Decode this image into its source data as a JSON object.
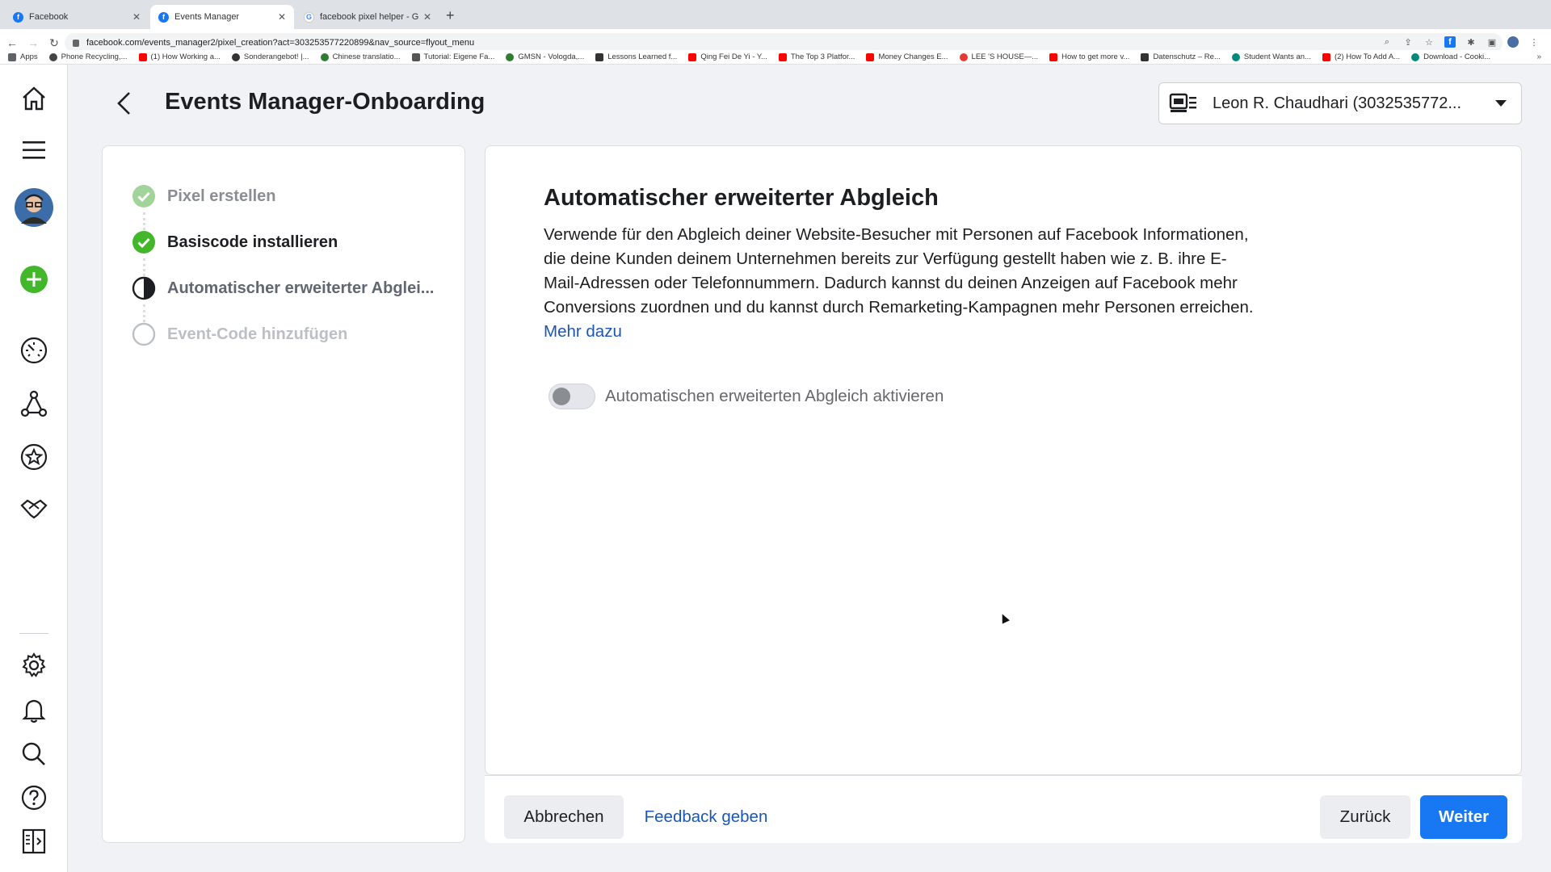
{
  "browser": {
    "tabs": [
      {
        "label": "Facebook",
        "active": false,
        "favicon": "facebook-icon",
        "color": "#1877f2"
      },
      {
        "label": "Events Manager",
        "active": true,
        "favicon": "facebook-icon",
        "color": "#1877f2"
      },
      {
        "label": "facebook pixel helper - Google",
        "active": false,
        "favicon": "google-icon",
        "color": "#4285f4"
      }
    ],
    "url": "facebook.com/events_manager2/pixel_creation?act=303253577220899&nav_source=flyout_menu",
    "bookmarks": [
      {
        "label": "Apps",
        "color": "#5f6368"
      },
      {
        "label": "Phone Recycling,...",
        "color": "#444444"
      },
      {
        "label": "(1) How Working a...",
        "color": "#ff0000"
      },
      {
        "label": "Sonderangebot! |...",
        "color": "#333333"
      },
      {
        "label": "Chinese translatio...",
        "color": "#2e7d32"
      },
      {
        "label": "Tutorial: Eigene Fa...",
        "color": "#555555"
      },
      {
        "label": "GMSN - Vologda,...",
        "color": "#2e7d32"
      },
      {
        "label": "Lessons Learned f...",
        "color": "#333333"
      },
      {
        "label": "Qing Fei De Yi - Y...",
        "color": "#ff0000"
      },
      {
        "label": "The Top 3 Platfor...",
        "color": "#ff0000"
      },
      {
        "label": "Money Changes E...",
        "color": "#ff0000"
      },
      {
        "label": "LEE 'S HOUSE—...",
        "color": "#e53935"
      },
      {
        "label": "How to get more v...",
        "color": "#ff0000"
      },
      {
        "label": "Datenschutz – Re...",
        "color": "#333333"
      },
      {
        "label": "Student Wants an...",
        "color": "#00897b"
      },
      {
        "label": "(2) How To Add A...",
        "color": "#ff0000"
      },
      {
        "label": "Download - Cooki...",
        "color": "#00897b"
      }
    ],
    "bookmarks_more": "»"
  },
  "header": {
    "title": "Events Manager-Onboarding",
    "account_label": "Leon R. Chaudhari (3032535772..."
  },
  "steps": [
    {
      "label": "Pixel erstellen",
      "state": "done-muted"
    },
    {
      "label": "Basiscode installieren",
      "state": "done"
    },
    {
      "label": "Automatischer erweiterter Abglei...",
      "state": "current"
    },
    {
      "label": "Event-Code hinzufügen",
      "state": "todo"
    }
  ],
  "main": {
    "title": "Automatischer erweiterter Abgleich",
    "description": "Verwende für den Abgleich deiner Website-Besucher mit Personen auf Facebook Informationen, die deine Kunden deinem Unternehmen bereits zur Verfügung gestellt haben wie z. B. ihre E-Mail-Adressen oder Telefonnummern. Dadurch kannst du deinen Anzeigen auf Facebook mehr Conversions zuordnen und du kannst durch Remarketing-Kampagnen mehr Personen erreichen.",
    "learn_more": "Mehr dazu",
    "toggle_label": "Automatischen erweiterten Abgleich aktivieren",
    "toggle_on": false
  },
  "footer": {
    "cancel": "Abbrechen",
    "feedback": "Feedback geben",
    "back": "Zurück",
    "next": "Weiter"
  },
  "colors": {
    "primary": "#1877f2",
    "link": "#1b56b2",
    "success": "#42b72a",
    "success_muted": "#a1d39a"
  }
}
